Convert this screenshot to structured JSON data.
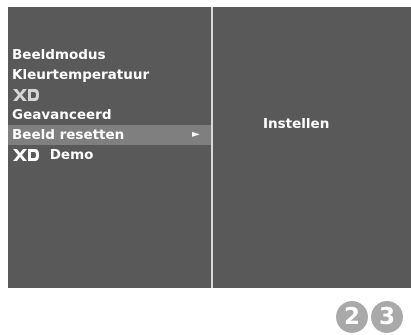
{
  "menu": {
    "items": [
      {
        "label": "Beeldmodus",
        "selected": false
      },
      {
        "label": "Kleurtemperatuur",
        "selected": false
      },
      {
        "label": "",
        "icon": "xd-logo-icon",
        "selected": false
      },
      {
        "label": "Geavanceerd",
        "selected": false
      },
      {
        "label": "Beeld resetten",
        "selected": true,
        "arrow": "►"
      },
      {
        "label": "Demo",
        "icon": "xd-logo-icon",
        "selected": false
      }
    ]
  },
  "submenu": {
    "label": "Instellen"
  },
  "steps": [
    "2",
    "3"
  ],
  "colors": {
    "panel": "#595959",
    "highlight": "#7f7f7f",
    "divider": "#d9d9d9",
    "badge": "#a9a9a9",
    "text": "#ffffff"
  }
}
